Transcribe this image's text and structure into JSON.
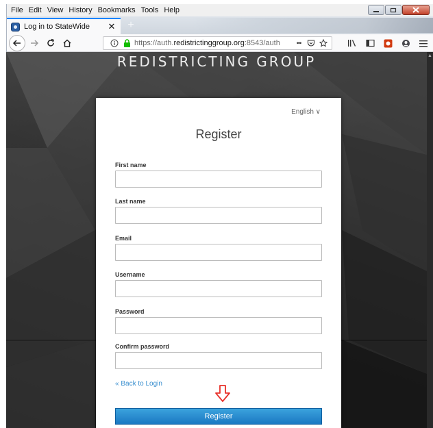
{
  "browser": {
    "menu": [
      {
        "label": "File"
      },
      {
        "label": "Edit"
      },
      {
        "label": "View"
      },
      {
        "label": "History"
      },
      {
        "label": "Bookmarks"
      },
      {
        "label": "Tools"
      },
      {
        "label": "Help"
      }
    ],
    "tab": {
      "title": "Log in to StateWide",
      "close": "✕"
    },
    "new_tab": "+",
    "url": {
      "prefix": "https://auth.",
      "domain": "redistrictinggroup.org",
      "suffix": ":8543/auth"
    },
    "url_more": "•••"
  },
  "page": {
    "brand": "REDISTRICTING GROUP",
    "language": "English ∨",
    "title": "Register",
    "fields": [
      {
        "label": "First name",
        "value": ""
      },
      {
        "label": "Last name",
        "value": ""
      },
      {
        "label": "Email",
        "value": ""
      },
      {
        "label": "Username",
        "value": ""
      },
      {
        "label": "Password",
        "value": ""
      },
      {
        "label": "Confirm password",
        "value": ""
      }
    ],
    "back_link": "« Back to Login",
    "register_button": "Register"
  },
  "colors": {
    "accent": "#1b78c2",
    "link": "#3a8fcf",
    "hint_arrow": "#e8312a"
  }
}
